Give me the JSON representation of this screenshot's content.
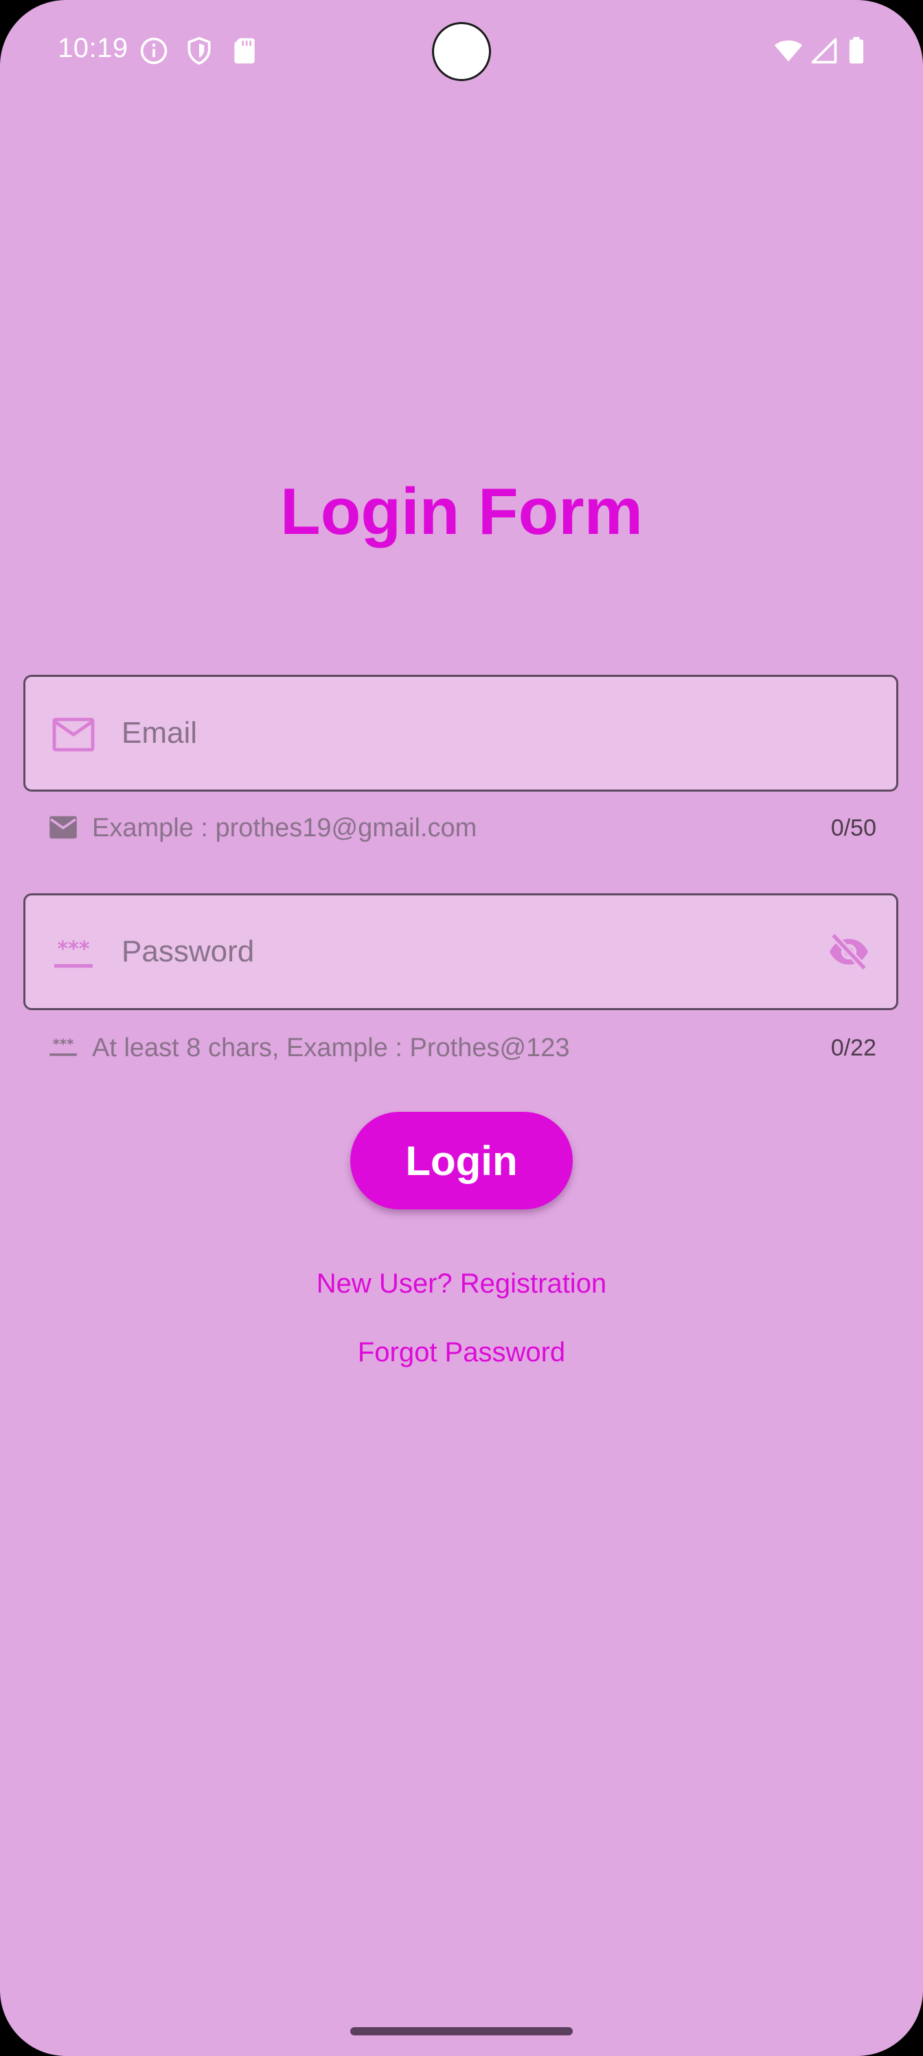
{
  "status_bar": {
    "time": "10:19",
    "icons_left": [
      "info-icon",
      "shield-icon",
      "sd-card-icon"
    ],
    "icons_right": [
      "wifi-icon",
      "cell-signal-icon",
      "battery-icon"
    ]
  },
  "title": "Login Form",
  "email": {
    "placeholder": "Email",
    "value": "",
    "helper": "Example : prothes19@gmail.com",
    "counter": "0/50",
    "icon": "mail-icon"
  },
  "password": {
    "placeholder": "Password",
    "value": "",
    "helper": "At least 8 chars, Example : Prothes@123",
    "counter": "0/22",
    "icon": "password-icon",
    "toggle_icon": "visibility-off-icon"
  },
  "login_button": "Login",
  "links": {
    "register": "New User? Registration",
    "forgot": "Forgot Password"
  },
  "colors": {
    "background": "#dfa8e0",
    "accent": "#dc0bd9",
    "field_fill": "#e9c1e9",
    "field_border": "#5d4960",
    "helper_text": "#8a728b"
  }
}
